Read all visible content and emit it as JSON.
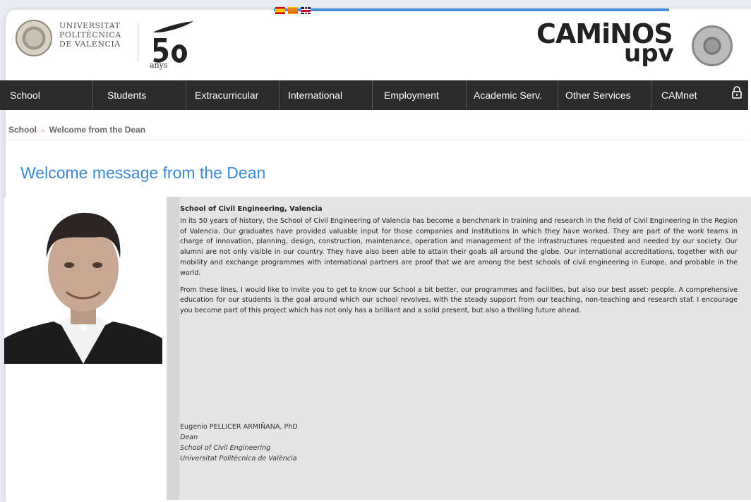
{
  "header": {
    "university_lines": [
      "UNIVERSITAT",
      "POLITÈCNICA",
      "DE VALÈNCIA"
    ],
    "anniversary_label": "anys",
    "brand_top": "CAMiNOS",
    "brand_bottom": "upv",
    "languages": [
      "es",
      "ca",
      "en"
    ]
  },
  "nav": {
    "items": [
      "School",
      "Students",
      "Extracurricular",
      "International",
      "Employment",
      "Academic Serv.",
      "Other Services",
      "CAMnet"
    ]
  },
  "breadcrumb": {
    "items": [
      "School",
      "Welcome from the Dean"
    ],
    "separator": "»"
  },
  "page": {
    "title": "Welcome message from the Dean",
    "heading": "School of Civil Engineering, Valencia",
    "paragraphs": [
      "In its 50 years of history, the School of Civil Engineering of Valencia has become a benchmark in training and research in the field of Civil Engineering in the Region of Valencia. Our graduates have provided valuable input for those companies and institutions in which they have worked. They are part of the work teams in charge of innovation, planning, design, construction, maintenance, operation and management of the infrastructures requested and needed by our society. Our alumni are not only visible in our country. They have also been able to attain their goals all around the globe. Our international accreditations, together with our mobility and exchange programmes with international partners are proof that we are among the best schools of civil engineering in Europe, and probable in the world.",
      "From these lines, I would like to invite you to get to know our School a bit better, our programmes and facilities, but also our best asset: people. A comprehensive education for our students is the goal around which our school revolves, with the steady support from our teaching, non-teaching and research staf. I encourage you become part of this project which has not only has a brilliant and a solid present, but also a thrilling future ahead."
    ],
    "signature": {
      "name": "Eugenio PELLICER ARMIÑANA, PhD",
      "role": "Dean",
      "school": "School of Civil Engineering",
      "university": "Universitat Politècnica de València"
    }
  },
  "colors": {
    "nav_bg": "#2b2b2b",
    "title": "#3c8ad4",
    "content_bg": "#e4e4e4"
  }
}
